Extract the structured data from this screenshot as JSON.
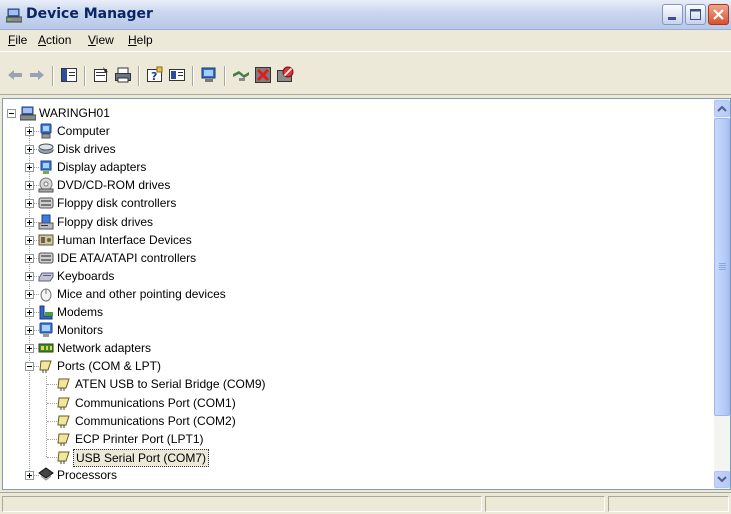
{
  "window": {
    "title": "Device Manager"
  },
  "menu": [
    {
      "key": "F",
      "rest": "ile"
    },
    {
      "key": "A",
      "rest": "ction"
    },
    {
      "key": "V",
      "rest": "iew"
    },
    {
      "key": "H",
      "rest": "elp"
    }
  ],
  "toolbar": {
    "icons": [
      "back-arrow-icon",
      "forward-arrow-icon",
      "show-hide-tree-icon",
      "properties-icon",
      "print-icon",
      "help-icon",
      "view-icon",
      "scan-hardware-icon",
      "update-driver-icon",
      "uninstall-icon",
      "disable-icon"
    ]
  },
  "tree": {
    "root": "WARINGH01",
    "categories": [
      {
        "label": "Computer",
        "icon": "computer-icon"
      },
      {
        "label": "Disk drives",
        "icon": "disk-drive-icon"
      },
      {
        "label": "Display adapters",
        "icon": "display-adapter-icon"
      },
      {
        "label": "DVD/CD-ROM drives",
        "icon": "dvd-drive-icon"
      },
      {
        "label": "Floppy disk controllers",
        "icon": "floppy-controller-icon"
      },
      {
        "label": "Floppy disk drives",
        "icon": "floppy-drive-icon"
      },
      {
        "label": "Human Interface Devices",
        "icon": "hid-icon"
      },
      {
        "label": "IDE ATA/ATAPI controllers",
        "icon": "ide-controller-icon"
      },
      {
        "label": "Keyboards",
        "icon": "keyboard-icon"
      },
      {
        "label": "Mice and other pointing devices",
        "icon": "mouse-icon"
      },
      {
        "label": "Modems",
        "icon": "modem-icon"
      },
      {
        "label": "Monitors",
        "icon": "monitor-icon"
      },
      {
        "label": "Network adapters",
        "icon": "network-adapter-icon"
      },
      {
        "label": "Ports (COM & LPT)",
        "icon": "port-icon"
      },
      {
        "label": "Processors",
        "icon": "processor-icon"
      }
    ],
    "ports": [
      "ATEN USB to Serial Bridge (COM9)",
      "Communications Port (COM1)",
      "Communications Port (COM2)",
      "ECP Printer Port (LPT1)",
      "USB Serial Port (COM7)"
    ]
  }
}
